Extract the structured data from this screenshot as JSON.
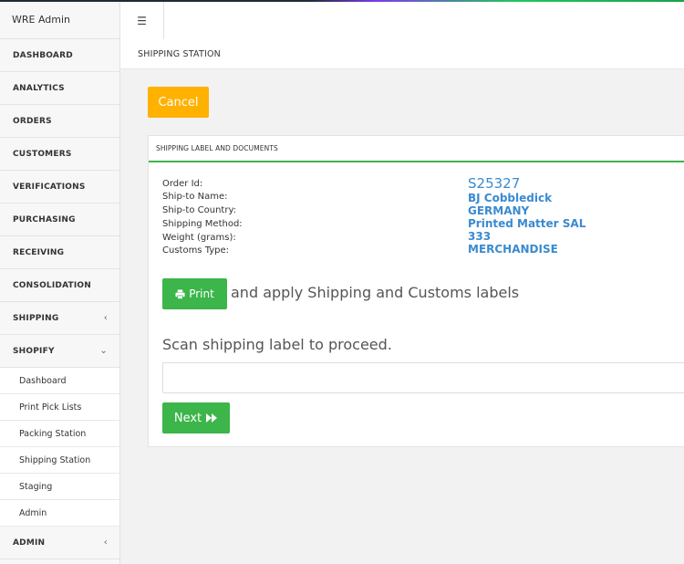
{
  "brand": "WRE Admin",
  "nav": {
    "dashboard": "DASHBOARD",
    "analytics": "ANALYTICS",
    "orders": "ORDERS",
    "customers": "CUSTOMERS",
    "verifications": "VERIFICATIONS",
    "purchasing": "PURCHASING",
    "receiving": "RECEIVING",
    "consolidation": "CONSOLIDATION",
    "shipping": "SHIPPING",
    "shopify": "SHOPIFY",
    "admin": "ADMIN",
    "shopify_sub": [
      "Dashboard",
      "Print Pick Lists",
      "Packing Station",
      "Shipping Station",
      "Staging",
      "Admin"
    ]
  },
  "header": {
    "breadcrumb": "SHIPPING STATION"
  },
  "actions": {
    "cancel": "Cancel",
    "print": "Print",
    "next": "Next"
  },
  "panel": {
    "title": "SHIPPING LABEL AND DOCUMENTS",
    "labels": [
      "Order Id:",
      "Ship-to Name:",
      "Ship-to Country:",
      "Shipping Method:",
      "Weight (grams):",
      "Customs Type:"
    ],
    "values": [
      "S25327",
      "BJ Cobbledick",
      "GERMANY",
      "Printed Matter SAL",
      "333",
      "MERCHANDISE"
    ],
    "print_text": "and apply Shipping and Customs labels",
    "scan_text": "Scan shipping label to proceed.",
    "scan_value": ""
  },
  "colors": {
    "accent_green": "#3cb54a",
    "cancel_orange": "#ffb100",
    "value_blue": "#3a8ad0"
  },
  "icons": {
    "menu": "hamburger-icon",
    "print": "print-icon",
    "next": "fast-forward-icon",
    "collapsed": "chevron-left-icon",
    "expanded": "chevron-down-icon"
  }
}
